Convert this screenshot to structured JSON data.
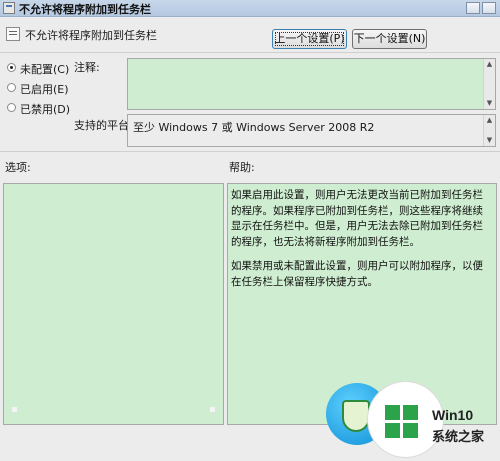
{
  "window": {
    "title": "不允许将程序附加到任务栏"
  },
  "header": {
    "policy_title": "不允许将程序附加到任务栏",
    "prev_button": "上一个设置(P)",
    "next_button": "下一个设置(N)"
  },
  "state": {
    "selected": "not_configured",
    "options": [
      {
        "key": "not_configured",
        "label": "未配置(C)"
      },
      {
        "key": "enabled",
        "label": "已启用(E)"
      },
      {
        "key": "disabled",
        "label": "已禁用(D)"
      }
    ]
  },
  "comment": {
    "label": "注释:",
    "value": ""
  },
  "platform": {
    "label": "支持的平台:",
    "value": "至少 Windows 7 或 Windows Server 2008 R2"
  },
  "options_panel": {
    "label": "选项:"
  },
  "help_panel": {
    "label": "帮助:",
    "paragraphs": [
      "如果启用此设置，则用户无法更改当前已附加到任务栏的程序。如果程序已附加到任务栏，则这些程序将继续显示在任务栏中。但是，用户无法去除已附加到任务栏的程序，也无法将新程序附加到任务栏。",
      "如果禁用或未配置此设置，则用户可以附加程序，以便在任务栏上保留程序快捷方式。"
    ]
  },
  "watermark": {
    "brand": "Win10",
    "subtitle": "系统之家",
    "brand_color": "#2aa34a"
  }
}
